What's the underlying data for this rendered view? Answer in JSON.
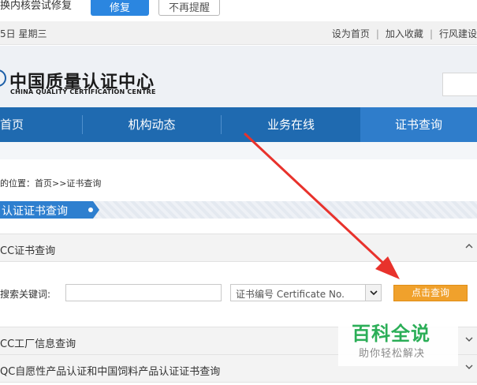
{
  "notice": {
    "text": "换内核尝试修复",
    "fix_label": "修复",
    "no_remind_label": "不再提醒"
  },
  "topbar": {
    "date": "5日 星期三",
    "links": [
      "设为首页",
      "加入收藏",
      "行风建设"
    ]
  },
  "header": {
    "logo_cn": "中国质量认证中心",
    "logo_en": "CHINA QUALITY CERTIFICATION CENTRE"
  },
  "nav": {
    "items": [
      "首页",
      "机构动态",
      "业务在线",
      "证书查询"
    ],
    "active_index": 3
  },
  "breadcrumb": "的位置：首页>>证书查询",
  "banner": {
    "title": "认证证书查询"
  },
  "sections": {
    "ccc": {
      "title": "CC证书查询",
      "chevron": "^"
    },
    "factory": {
      "title": "CC工厂信息查询",
      "chevron": "v"
    },
    "voluntary": {
      "title": "QC自愿性产品认证和中国饲料产品认证证书查询",
      "chevron": "v"
    }
  },
  "search": {
    "label": "搜索关键词:",
    "keyword_value": "",
    "select_value": "证书编号 Certificate No.",
    "query_label": "点击查询"
  },
  "watermark": {
    "main": "百科全说",
    "sub": "助你轻松解决"
  },
  "colors": {
    "nav_bg": "#1f6ab0",
    "nav_active": "#2f7dcb",
    "fix_button": "#2b86e0",
    "query_button": "#f0a12c",
    "arrow": "#e8322c",
    "watermark": "#2bae57"
  },
  "icons": {
    "select_arrow": "chevron-down-icon",
    "expanded": "chevron-up-icon",
    "collapsed": "chevron-down-icon"
  }
}
